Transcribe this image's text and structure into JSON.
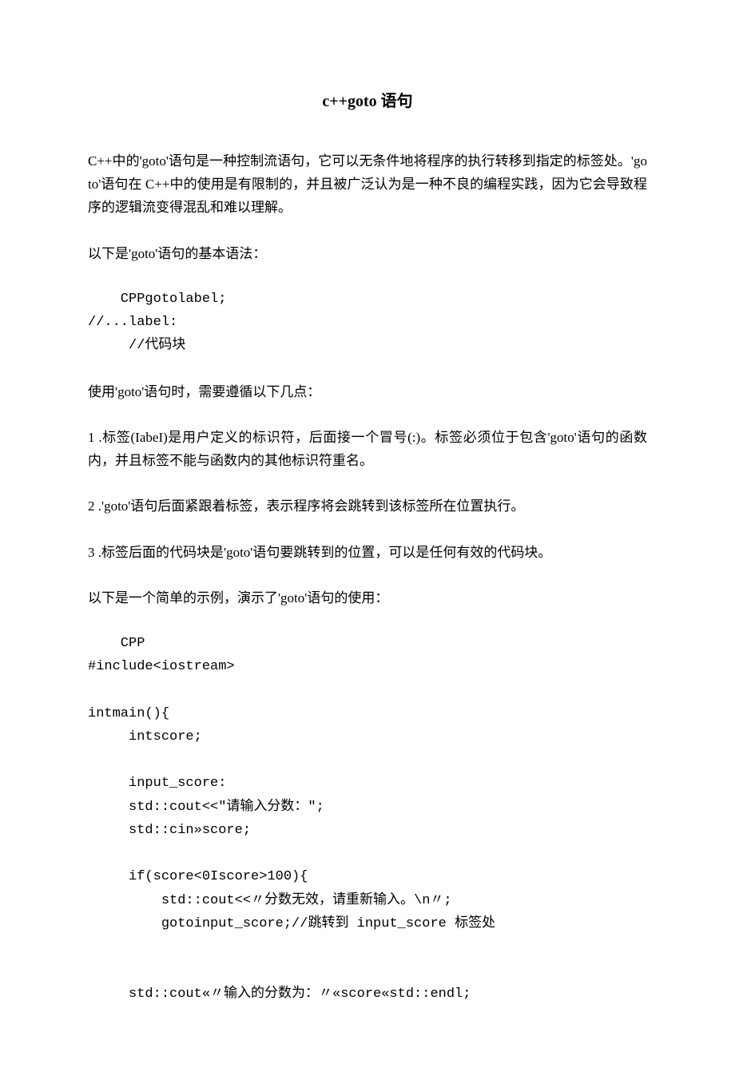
{
  "title": "c++goto 语句",
  "p1": "C++中的'goto'语句是一种控制流语句，它可以无条件地将程序的执行转移到指定的标签处。'goto'语句在 C++中的使用是有限制的，并且被广泛认为是一种不良的编程实践，因为它会导致程序的逻辑流变得混乱和难以理解。",
  "p2": "以下是'goto'语句的基本语法：",
  "code1": "    CPPgotolabel;\n//...label:\n     //代码块",
  "p3": "使用'goto'语句时，需要遵循以下几点：",
  "li1": "1 .标签(IabeI)是用户定义的标识符，后面接一个冒号(:)。标签必须位于包含'goto'语句的函数内，并且标签不能与函数内的其他标识符重名。",
  "li2": "2 .'goto'语句后面紧跟着标签，表示程序将会跳转到该标签所在位置执行。",
  "li3": "3 .标签后面的代码块是'goto'语句要跳转到的位置，可以是任何有效的代码块。",
  "p4": "以下是一个简单的示例，演示了'goto'语句的使用：",
  "code2": "    CPP\n#include<iostream>\n\nintmain(){\n     intscore;\n\n     input_score:\n     std::cout<<\"请输入分数：\";\n     std::cin»score;\n\n     if(score<0Iscore>100){\n         std::cout<<〃分数无效，请重新输入。\\n〃;\n         gotoinput_score;//跳转到 input_score 标签处\n\n\n     std::cout«〃输入的分数为：〃«score«std::endl;"
}
